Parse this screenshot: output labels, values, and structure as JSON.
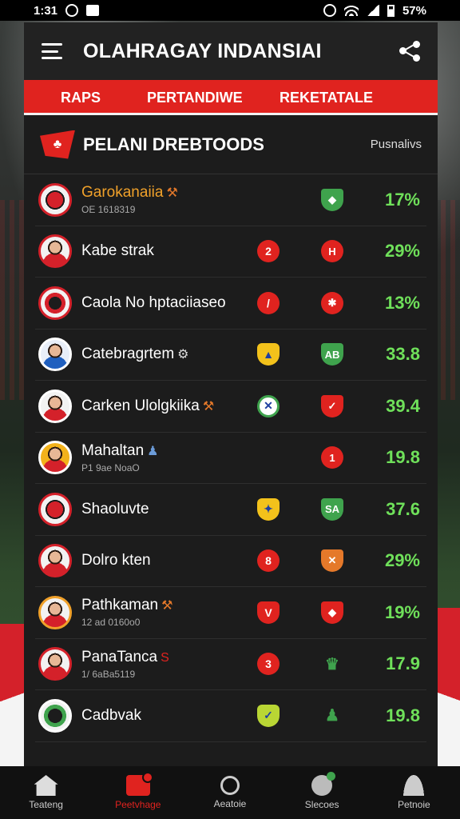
{
  "status_bar": {
    "time": "1:31",
    "battery": "57%"
  },
  "app": {
    "title": "OLAHRAGAY INDANSIAI"
  },
  "tabs": [
    {
      "label": "RAPS"
    },
    {
      "label": "PERTANDIWE"
    },
    {
      "label": "REKETATALE"
    }
  ],
  "section": {
    "title": "PELANI DREBTOODS",
    "side_label": "Pusnalivs"
  },
  "rows": [
    {
      "name": "Garokanaiia",
      "sub": "OE 1618319",
      "extra": "⚒",
      "col1": "",
      "col2": "",
      "pct": "17%"
    },
    {
      "name": "Kabe strak",
      "sub": "",
      "extra": "",
      "col1": "2",
      "col2": "H",
      "pct": "29%"
    },
    {
      "name": "Caola No hptaciiaseo",
      "sub": "",
      "extra": "",
      "col1": "/",
      "col2": "✱",
      "pct": "13%"
    },
    {
      "name": "Catebragrtem",
      "sub": "",
      "extra": "⚙",
      "col1": "",
      "col2": "AB",
      "pct": "33.8"
    },
    {
      "name": "Carken Ulolgkiika",
      "sub": "",
      "extra": "⚒",
      "col1": "",
      "col2": "",
      "pct": "39.4"
    },
    {
      "name": "Mahaltan",
      "sub": "P1 9ae NoaO",
      "extra": "♟",
      "col1": "",
      "col2": "1",
      "pct": "19.8"
    },
    {
      "name": "Shaoluvte",
      "sub": "",
      "extra": "",
      "col1": "",
      "col2": "SA",
      "pct": "37.6"
    },
    {
      "name": "Dolro kten",
      "sub": "",
      "extra": "",
      "col1": "8",
      "col2": "",
      "pct": "29%"
    },
    {
      "name": "Pathkaman",
      "sub": "12 ad 0160o0",
      "extra": "⚒",
      "col1": "",
      "col2": "",
      "pct": "19%"
    },
    {
      "name": "PanaTanca",
      "sub": "1/ 6aBa5119",
      "extra": "S",
      "col1": "3",
      "col2": "♛",
      "pct": "17.9"
    },
    {
      "name": "Cadbvak",
      "sub": "",
      "extra": "",
      "col1": "",
      "col2": "♟",
      "pct": "19.8"
    }
  ],
  "bottom_nav": [
    {
      "label": "Teateng"
    },
    {
      "label": "Peetvhage"
    },
    {
      "label": "Aeatoie"
    },
    {
      "label": "Slecoes"
    },
    {
      "label": "Petnoie"
    }
  ]
}
